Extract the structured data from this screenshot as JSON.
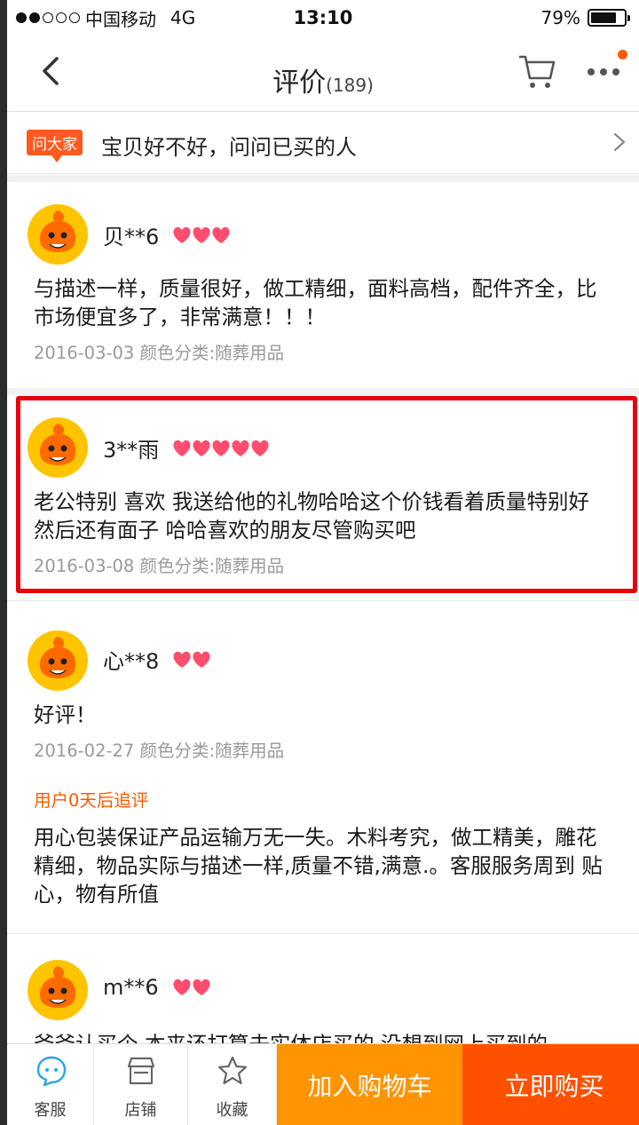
{
  "status_bar": {
    "carrier": "中国移动",
    "network": "4G",
    "time": "13:10",
    "battery_percent": "79%",
    "battery_level": 0.79,
    "signal_bars": 2
  },
  "nav": {
    "title": "评价",
    "count": "(189)"
  },
  "ask": {
    "tag": "问大家",
    "text": "宝贝好不好，问问已买的人"
  },
  "reviews": [
    {
      "user": "贝**6",
      "hearts": 3,
      "content": "与描述一样，质量很好，做工精细，面料高档，配件齐全，比市场便宜多了，非常满意！！！",
      "meta": "2016-03-03 颜色分类:随葬用品"
    },
    {
      "user": "3**雨",
      "hearts": 5,
      "content": "老公特别 喜欢 我送给他的礼物哈哈这个价钱看着质量特别好然后还有面子 哈哈喜欢的朋友尽管购买吧",
      "meta": "2016-03-08 颜色分类:随葬用品"
    },
    {
      "user": "心**8",
      "hearts": 2,
      "content": "好评！",
      "meta": "2016-02-27 颜色分类:随葬用品",
      "follow_label": "用户0天后追评",
      "follow_content": "用心包装保证产品运输万无一失。木料考究，做工精美，雕花精细，物品实际与描述一样,质量不错,满意.。客服服务周到 贴心，物有所值"
    },
    {
      "user": "m**6",
      "hearts": 2,
      "content": "爷爷认买个 本来还打算去实体店买的 没想到网上买到的"
    }
  ],
  "bottom_bar": {
    "service": "客服",
    "store": "店铺",
    "favorite": "收藏",
    "add_to_cart": "加入购物车",
    "buy_now": "立即购买"
  },
  "colors": {
    "accent": "#ff5000",
    "cart_button": "#ff9402",
    "highlight": "#e8000a",
    "heart": "#ff4d6d"
  },
  "icons": [
    "back-icon",
    "cart-icon",
    "more-icon",
    "chevron-right-icon",
    "avatar-icon",
    "heart-icon",
    "service-icon",
    "store-icon",
    "star-icon"
  ]
}
